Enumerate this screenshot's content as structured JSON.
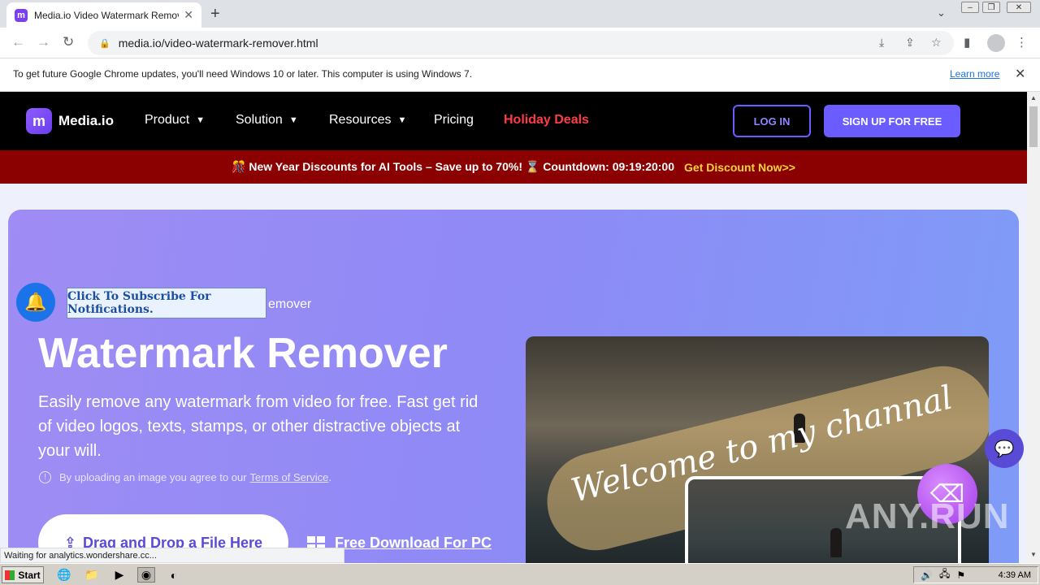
{
  "browser": {
    "tab_title": "Media.io Video Watermark Remover",
    "tab_favicon": "m",
    "url": "media.io/video-watermark-remover.html"
  },
  "infobar": {
    "message": "To get future Google Chrome updates, you'll need Windows 10 or later. This computer is using Windows 7.",
    "learn_more": "Learn more"
  },
  "site_nav": {
    "brand": "Media.io",
    "brand_logo": "m",
    "items": [
      {
        "label": "Product"
      },
      {
        "label": "Solution"
      },
      {
        "label": "Resources"
      },
      {
        "label": "Pricing"
      },
      {
        "label": "Holiday Deals"
      }
    ],
    "login": "LOG IN",
    "signup": "SIGN UP FOR FREE"
  },
  "promo": {
    "text": "🎊 New Year Discounts for AI Tools – Save up to 70%! ⌛ Countdown: 09:19:20:00",
    "cta": "Get Discount Now>>"
  },
  "hero": {
    "breadcrumb": "emover",
    "title": "Watermark Remover",
    "lead": "Easily remove any watermark from video for free. Fast get rid of video logos, texts, stamps, or other distractive objects at your will.",
    "agree_text": "By uploading an image you agree to our",
    "tos": "Terms of Service",
    "agree_end": ".",
    "drag_button": "Drag and Drop a File Here",
    "download_link": "Free Download For PC",
    "media_script": "Welcome to my channal"
  },
  "notification": {
    "subscribe": "Click To Subscribe For Notifications."
  },
  "watermark": "ANY.RUN",
  "status": "Waiting for analytics.wondershare.cc...",
  "taskbar": {
    "start": "Start",
    "clock": "4:39 AM"
  },
  "colors": {
    "accent": "#6a5cff",
    "promo_bg": "#8b0000",
    "holiday": "#ff3b47",
    "cta": "#ffd43b"
  }
}
